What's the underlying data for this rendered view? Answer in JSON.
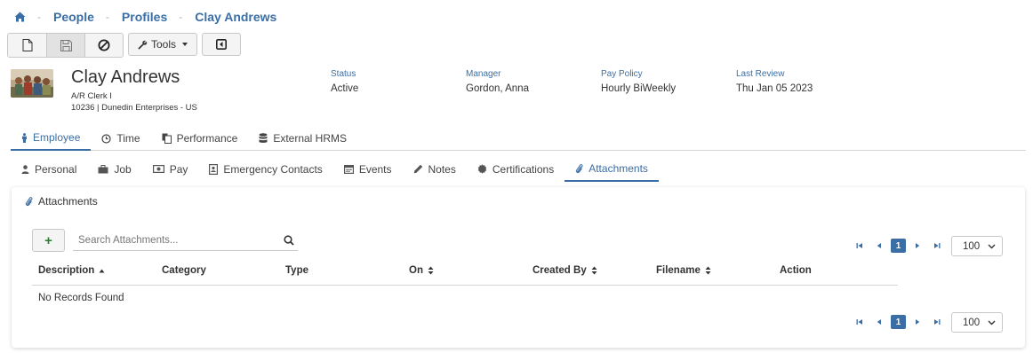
{
  "breadcrumb": {
    "home_icon": "home-icon",
    "items": [
      "People",
      "Profiles",
      "Clay Andrews"
    ],
    "separator": "-"
  },
  "toolbar": {
    "new_icon": "new-document-icon",
    "save_icon": "save-icon",
    "cancel_icon": "cancel-icon",
    "tools_label": "Tools",
    "tools_icon": "wrench-icon",
    "collapse_icon": "collapse-left-icon"
  },
  "profile": {
    "name": "Clay Andrews",
    "job_title": "A/R Clerk I",
    "employee_line": "10236 | Dunedin Enterprises - US",
    "info": [
      {
        "label": "Status",
        "value": "Active"
      },
      {
        "label": "Manager",
        "value": "Gordon, Anna"
      },
      {
        "label": "Pay Policy",
        "value": "Hourly BiWeekly"
      },
      {
        "label": "Last Review",
        "value": "Thu Jan 05 2023"
      }
    ]
  },
  "main_tabs": [
    {
      "label": "Employee",
      "icon": "person-icon",
      "active": true
    },
    {
      "label": "Time",
      "icon": "clock-icon",
      "active": false
    },
    {
      "label": "Performance",
      "icon": "documents-icon",
      "active": false
    },
    {
      "label": "External HRMS",
      "icon": "database-icon",
      "active": false
    }
  ],
  "sub_tabs": [
    {
      "label": "Personal",
      "icon": "user-icon",
      "active": false
    },
    {
      "label": "Job",
      "icon": "briefcase-icon",
      "active": false
    },
    {
      "label": "Pay",
      "icon": "money-icon",
      "active": false
    },
    {
      "label": "Emergency Contacts",
      "icon": "contact-book-icon",
      "active": false
    },
    {
      "label": "Events",
      "icon": "calendar-icon",
      "active": false
    },
    {
      "label": "Notes",
      "icon": "pencil-icon",
      "active": false
    },
    {
      "label": "Certifications",
      "icon": "certificate-icon",
      "active": false
    },
    {
      "label": "Attachments",
      "icon": "paperclip-icon",
      "active": true
    }
  ],
  "attachments": {
    "title": "Attachments",
    "add_label": "+",
    "search": {
      "placeholder": "Search Attachments...",
      "value": ""
    },
    "pager": {
      "current_page": "1",
      "page_size": "100"
    },
    "columns": [
      {
        "label": "Description",
        "sort": "asc"
      },
      {
        "label": "Category",
        "sort": "none"
      },
      {
        "label": "Type",
        "sort": "none"
      },
      {
        "label": "On",
        "sort": "sortable"
      },
      {
        "label": "Created By",
        "sort": "sortable"
      },
      {
        "label": "Filename",
        "sort": "sortable"
      },
      {
        "label": "Action",
        "sort": "none"
      }
    ],
    "empty_message": "No Records Found"
  },
  "colors": {
    "accent": "#3a6ea5",
    "add_green": "#2e7d32"
  }
}
